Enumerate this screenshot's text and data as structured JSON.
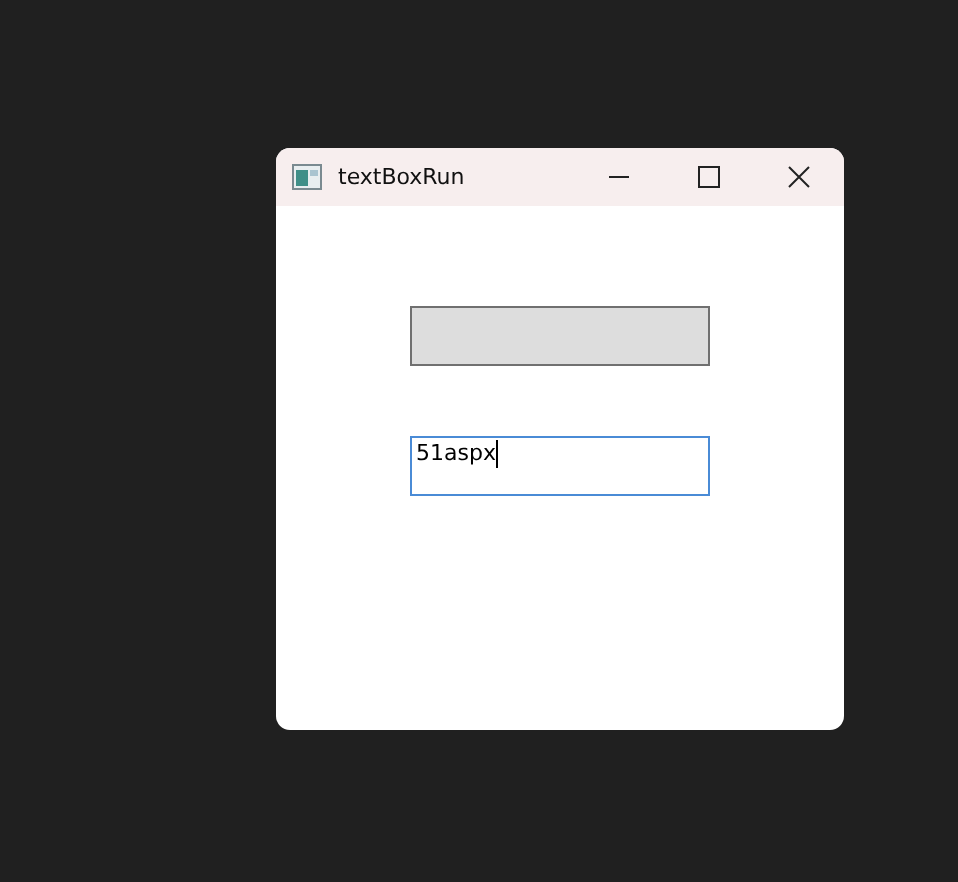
{
  "window": {
    "title": "textBoxRun"
  },
  "controls": [
    {
      "kind": "button"
    },
    {
      "kind": "textbox",
      "value": "51aspx",
      "focused": true
    }
  ]
}
